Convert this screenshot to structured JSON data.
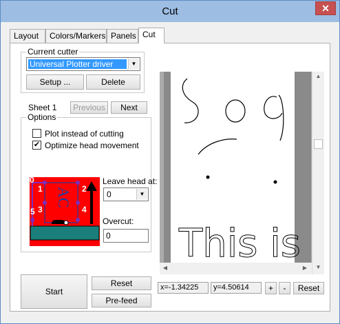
{
  "window": {
    "title": "Cut",
    "close_glyph": "✕"
  },
  "tabs": [
    {
      "label": "Layout",
      "active": false
    },
    {
      "label": "Colors/Markers",
      "active": false
    },
    {
      "label": "Panels",
      "active": false
    },
    {
      "label": "Cut",
      "active": true
    }
  ],
  "current_cutter": {
    "group_label": "Current cutter",
    "selected_value": "Universal Plotter driver",
    "setup_label": "Setup ...",
    "delete_label": "Delete"
  },
  "sheet": {
    "label": "Sheet 1",
    "previous_label": "Previous",
    "next_label": "Next"
  },
  "options": {
    "group_label": "Options",
    "plot_instead": {
      "label": "Plot instead of cutting",
      "checked": false
    },
    "optimize_head": {
      "label": "Optimize head movement",
      "checked": true
    },
    "leave_head_label": "Leave head at:",
    "leave_head_value": "0",
    "overcut_label": "Overcut:",
    "overcut_value": "0",
    "diagram_numbers": [
      "0",
      "1",
      "2",
      "3",
      "4",
      "5"
    ],
    "diagram_text": "AC"
  },
  "actions": {
    "start_label": "Start",
    "reset_label": "Reset",
    "prefeed_label": "Pre-feed"
  },
  "preview": {
    "top_text": "So",
    "bottom_text": "This is a So"
  },
  "coords": {
    "x_label": "x=-1.34225",
    "y_label": "y=4.50614",
    "zoom_in_label": "+",
    "zoom_out_label": "-",
    "reset_label": "Reset"
  },
  "colors": {
    "accent": "#3399ff",
    "diagram_bg": "#ff0000",
    "diagram_marker": "#7b2fbe",
    "platform": "#1a7f7a"
  }
}
